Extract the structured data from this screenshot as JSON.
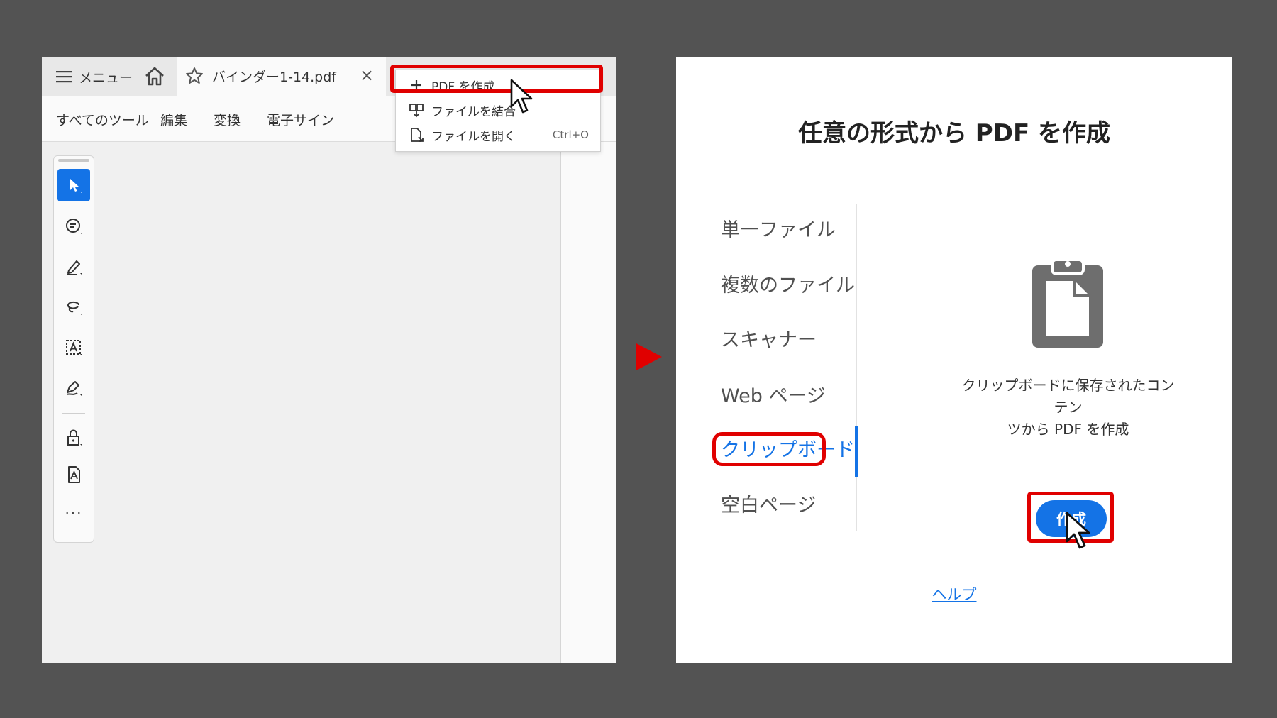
{
  "left_window": {
    "menu_label": "メニュー",
    "tab_title": "バインダー1-14.pdf",
    "close_glyph": "×",
    "tools_row": [
      "すべてのツール",
      "編集",
      "変換",
      "電子サイン"
    ],
    "dropdown": [
      {
        "label": "PDF を作成",
        "icon": "plus-icon",
        "shortcut": ""
      },
      {
        "label": "ファイルを結合",
        "icon": "combine-files-icon",
        "shortcut": ""
      },
      {
        "label": "ファイルを開く",
        "icon": "open-file-icon",
        "shortcut": "Ctrl+O"
      }
    ],
    "toolbar_tools": [
      "select-icon",
      "comment-icon",
      "highlight-pen-icon",
      "lasso-icon",
      "text-recognition-icon",
      "signature-icon",
      "protect-icon",
      "pdf-convert-icon"
    ],
    "more_label": "..."
  },
  "right_window": {
    "title": "任意の形式から PDF を作成",
    "sources": [
      {
        "label": "単一ファイル",
        "active": false
      },
      {
        "label": "複数のファイル",
        "active": false
      },
      {
        "label": "スキャナー",
        "active": false
      },
      {
        "label": "Web ページ",
        "active": false
      },
      {
        "label": "クリップボード",
        "active": true
      },
      {
        "label": "空白ページ",
        "active": false
      }
    ],
    "preview_icon": "clipboard-icon",
    "description_line1": "クリップボードに保存されたコンテン",
    "description_line2": "ツから PDF を作成",
    "create_button": "作成",
    "help_link": "ヘルプ"
  },
  "colors": {
    "background": "#535353",
    "accent": "#1473e6",
    "highlight": "#e00000"
  }
}
